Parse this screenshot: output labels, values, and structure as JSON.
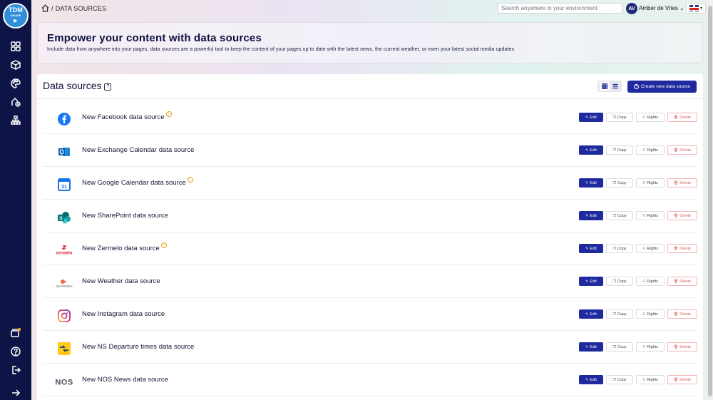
{
  "app": {
    "logo_text_1": "TDM",
    "logo_text_2": "ONLINE",
    "logo_play": "▶"
  },
  "breadcrumb": {
    "separator": "/",
    "label": "DATA SOURCES"
  },
  "search": {
    "placeholder": "Search anywhere in your environment"
  },
  "user": {
    "initials": "AV",
    "name": "Amber de Vries",
    "chevron": "⌄"
  },
  "language": {
    "flag": "uk-flag-icon",
    "caret": "▾"
  },
  "hero": {
    "title": "Empower your content with data sources",
    "subtitle": "Include data from anywhere into your pages, data sources are a powerful tool to keep the content of your pages up to date with the latest news, the current weather, or even your latest social media updates"
  },
  "panel": {
    "title": "Data sources",
    "help": "?",
    "create_label": "Create new data source",
    "create_plus": "+"
  },
  "actions": {
    "edit": "Edit",
    "copy": "Copy",
    "rights": "Rights",
    "delete": "Delete"
  },
  "sources": [
    {
      "name": "New Facebook data source",
      "icon": "facebook-icon",
      "info": true
    },
    {
      "name": "New Exchange Calendar data source",
      "icon": "outlook-icon",
      "info": false
    },
    {
      "name": "New Google Calendar data source",
      "icon": "google-calendar-icon",
      "info": true
    },
    {
      "name": "New SharePoint data source",
      "icon": "sharepoint-icon",
      "info": false
    },
    {
      "name": "New Zermelo data source",
      "icon": "zermelo-icon",
      "info": true
    },
    {
      "name": "New Weather data source",
      "icon": "openweather-icon",
      "info": false
    },
    {
      "name": "New Instagram data source",
      "icon": "instagram-icon",
      "info": false
    },
    {
      "name": "New NS Departure times data source",
      "icon": "ns-icon",
      "info": false
    },
    {
      "name": "New NOS News data source",
      "icon": "nos-icon",
      "info": false
    }
  ],
  "icon_text": {
    "gcal": "31",
    "ns": "NS",
    "nos": "NOS",
    "zermelo": "zermelo",
    "openweather": "OpenWeather",
    "info": "i"
  },
  "colors": {
    "sidebar": "#0e1445",
    "accent": "#1e2a9e",
    "delete": "#e05858",
    "info": "#e0a41a"
  }
}
